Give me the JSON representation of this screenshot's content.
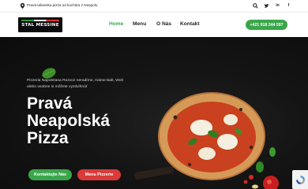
{
  "topbar": {
    "tagline": "Pravá talianska pizza od kuchára z Neapolu",
    "icons": [
      "map-pin-icon",
      "search-icon",
      "twitter-icon",
      "linkedin-icon",
      "facebook-icon"
    ]
  },
  "brand": {
    "logo_text": "STAL MESSINE",
    "colors": {
      "green": "#3aa64a",
      "red": "#d93a3a",
      "dark": "#111111"
    }
  },
  "nav": {
    "items": [
      {
        "label": "Home",
        "active": true
      },
      {
        "label": "Menu",
        "active": false
      },
      {
        "label": "O Nás",
        "active": false
      },
      {
        "label": "Kontakt",
        "active": false
      }
    ],
    "phone": "+421 918 244 597"
  },
  "hero": {
    "intro": "Pizzeria Napoletana Rozvoz neradíme, máme Balt, Wolt alebo osobne si môžete vyzdvihnúť",
    "headline_lines": [
      "Pravá",
      "Neapolská",
      "Pizza"
    ],
    "buttons": {
      "contact": "Kontaktujte Nás",
      "menu": "Menu Pizzerie"
    }
  }
}
